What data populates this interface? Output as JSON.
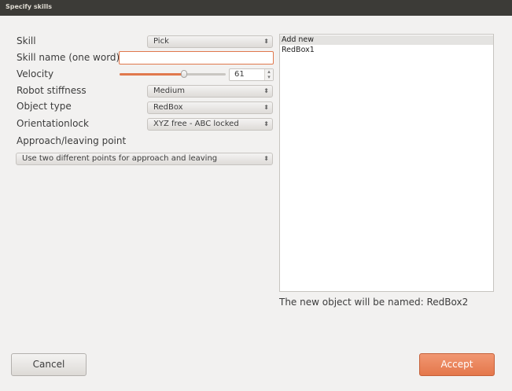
{
  "window": {
    "title": "Specify skills"
  },
  "form": {
    "skill": {
      "label": "Skill",
      "value": "Pick"
    },
    "skill_name": {
      "label": "Skill name (one word)",
      "value": ""
    },
    "velocity": {
      "label": "Velocity",
      "value": "61",
      "level_percent": 61
    },
    "stiffness": {
      "label": "Robot stiffness",
      "value": "Medium"
    },
    "object_type": {
      "label": "Object type",
      "value": "RedBox"
    },
    "orientation_lock": {
      "label": "Orientationlock",
      "value": "XYZ free - ABC locked"
    },
    "approach": {
      "label": "Approach/leaving point",
      "value": "Use two different points for approach and leaving"
    }
  },
  "object_list": {
    "items": [
      {
        "label": "Add new",
        "selected": true
      },
      {
        "label": "RedBox1",
        "selected": false
      }
    ],
    "note": "The new object will be named: RedBox2"
  },
  "buttons": {
    "cancel": "Cancel",
    "accept": "Accept"
  },
  "icons": {
    "combo_arrows": "updown-arrows-icon",
    "spin_arrows": "spin-arrows-icon"
  },
  "colors": {
    "accent": "#e4774b",
    "titlebar": "#3c3b37",
    "background": "#f2f1f0"
  }
}
